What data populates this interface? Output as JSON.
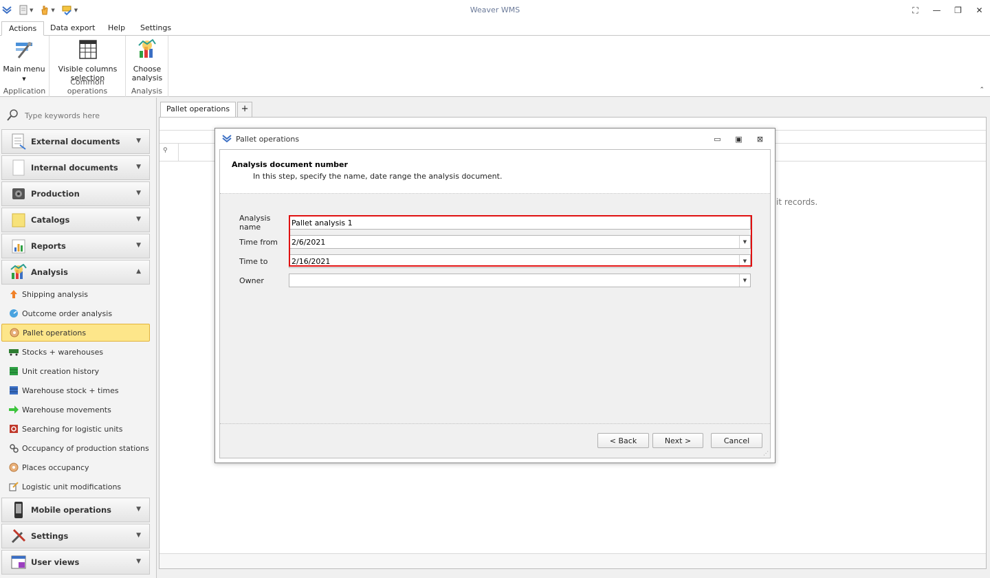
{
  "app": {
    "title": "Weaver WMS"
  },
  "ribbon": {
    "tabs": [
      "Actions",
      "Data export",
      "Help",
      "Settings"
    ],
    "groups": [
      {
        "name": "Application",
        "buttons": [
          {
            "label": "Main menu"
          }
        ]
      },
      {
        "name": "Common operations",
        "buttons": [
          {
            "label": "Visible columns selection"
          }
        ]
      },
      {
        "name": "Analysis",
        "buttons": [
          {
            "label": "Choose analysis"
          }
        ]
      }
    ]
  },
  "nav": {
    "search_placeholder": "Type keywords here",
    "groups": {
      "external": "External documents",
      "internal": "Internal documents",
      "production": "Production",
      "catalogs": "Catalogs",
      "reports": "Reports",
      "analysis": "Analysis",
      "mobile": "Mobile operations",
      "settings": "Settings",
      "userviews": "User views"
    },
    "analysis_items": [
      "Shipping analysis",
      "Outcome order analysis",
      "Pallet operations",
      "Stocks + warehouses",
      "Unit creation history",
      "Warehouse stock + times",
      "Warehouse movements",
      "Searching for logistic units",
      "Occupancy of production stations",
      "Places occupancy",
      "Logistic unit modifications"
    ],
    "selected": "Pallet operations"
  },
  "document": {
    "tab": "Pallet operations",
    "add_tab": "+",
    "empty_text": "it records."
  },
  "dialog": {
    "title": "Pallet operations",
    "step_title": "Analysis document number",
    "step_desc": "In this step, specify the name, date range the analysis document.",
    "fields": {
      "name_label": "Analysis name",
      "name_value": "Pallet analysis 1",
      "from_label": "Time from",
      "from_value": "2/6/2021",
      "to_label": "Time to",
      "to_value": "2/16/2021",
      "owner_label": "Owner",
      "owner_value": ""
    },
    "buttons": {
      "back": "< Back",
      "next": "Next >",
      "cancel": "Cancel"
    }
  },
  "colors": {
    "highlight": "#e01010",
    "selected_bg": "#fde68a",
    "title_text": "#6b7a99"
  }
}
